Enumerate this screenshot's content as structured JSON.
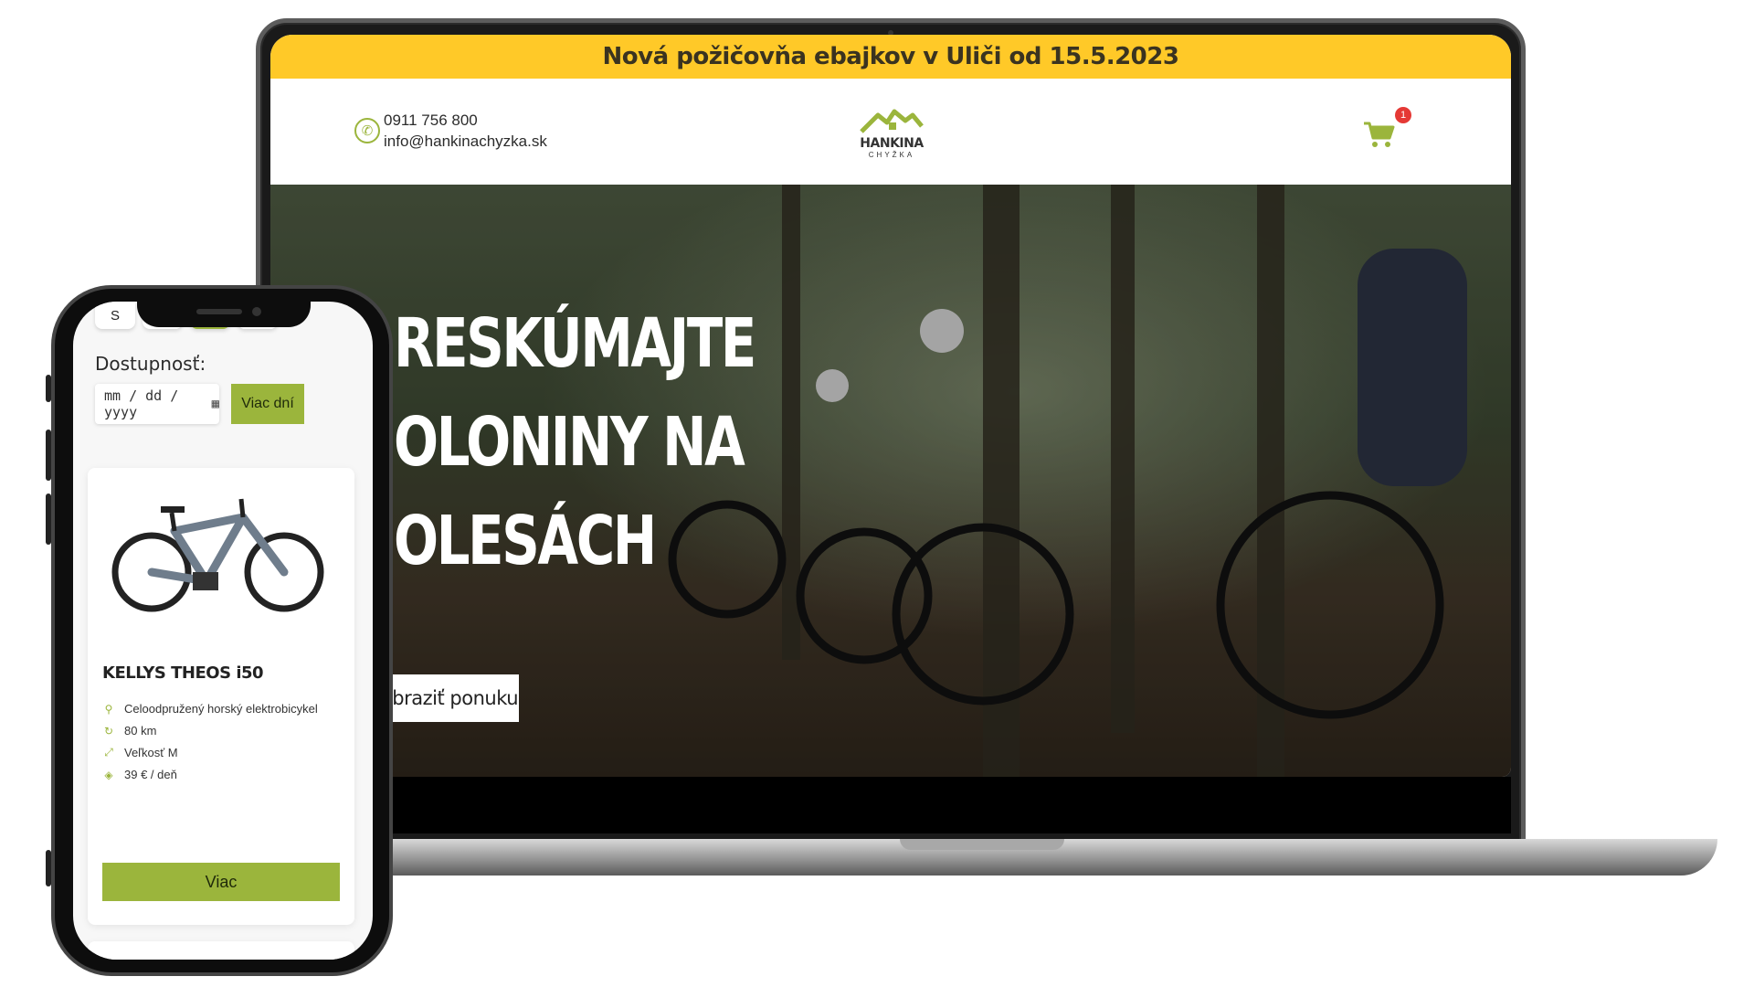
{
  "laptop_site": {
    "announcement": "Nová požičovňa ebajkov v Uliči od 15.5.2023",
    "contact": {
      "phone": "0911 756 800",
      "email": "info@hankinachyzka.sk"
    },
    "logo": {
      "name": "HANKINA",
      "sub": "CHYŽKA"
    },
    "cart": {
      "count": "1"
    },
    "hero": {
      "title_line1": "RESKÚMAJTE",
      "title_line2": "OLONINY NA",
      "title_line3": "OLESÁCH",
      "button": "obraziť ponuku"
    }
  },
  "mobile_site": {
    "size_chip": "S",
    "availability_label": "Dostupnosť:",
    "date_placeholder": "mm / dd / yyyy",
    "more_days_button": "Viac dní",
    "product": {
      "name": "KELLYS THEOS i50",
      "specs": [
        {
          "icon": "bicycle-icon",
          "text": "Celoodpružený horský elektrobicykel"
        },
        {
          "icon": "range-icon",
          "text": "80 km"
        },
        {
          "icon": "size-icon",
          "text": "Veľkosť M"
        },
        {
          "icon": "price-tag-icon",
          "text": "39 € / deň"
        }
      ],
      "more_button": "Viac"
    }
  },
  "colors": {
    "accent_green": "#9bb53c",
    "announcement_yellow": "#ffc928",
    "badge_red": "#e53935"
  }
}
